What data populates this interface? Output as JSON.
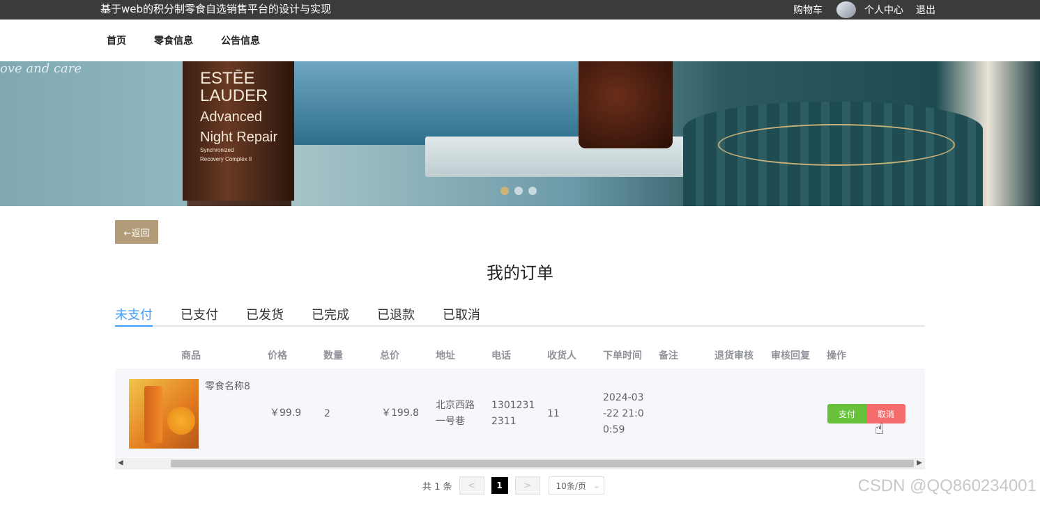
{
  "topbar": {
    "site_title": "基于web的积分制零食自选销售平台的设计与实现",
    "cart": "购物车",
    "user_center": "个人中心",
    "logout": "退出"
  },
  "nav": {
    "items": [
      "首页",
      "零食信息",
      "公告信息"
    ]
  },
  "banner": {
    "watermark": "ove and care",
    "bottle_line1": "ESTĒE",
    "bottle_line2": "LAUDER",
    "bottle_line3": "Advanced",
    "bottle_line4": "Night Repair",
    "bottle_line5": "Synchronized",
    "bottle_line6": "Recovery Complex II",
    "dots": 3,
    "active_dot": 0
  },
  "back_button": "←返回",
  "page_title": "我的订单",
  "tabs": {
    "items": [
      "未支付",
      "已支付",
      "已发货",
      "已完成",
      "已退款",
      "已取消"
    ],
    "active": 0
  },
  "table": {
    "headers": [
      "商品",
      "价格",
      "数量",
      "总价",
      "地址",
      "电话",
      "收货人",
      "下单时间",
      "备注",
      "退货审核",
      "审核回复",
      "操作"
    ],
    "rows": [
      {
        "product_name": "零食名称8",
        "price": "￥99.9",
        "quantity": "2",
        "total": "￥199.8",
        "address_l1": "北京西路",
        "address_l2": "一号巷",
        "phone_l1": "1301231",
        "phone_l2": "2311",
        "receiver": "11",
        "order_time_l1": "2024-03",
        "order_time_l2": "-22 21:0",
        "order_time_l3": "0:59",
        "remark": "",
        "return_review": "",
        "review_reply": "",
        "pay_label": "支付",
        "cancel_label": "取消"
      }
    ]
  },
  "pager": {
    "total": "共 1 条",
    "prev": "<",
    "current": "1",
    "next": ">",
    "page_size": "10条/页"
  },
  "footer_mark": "CSDN @QQ860234001"
}
